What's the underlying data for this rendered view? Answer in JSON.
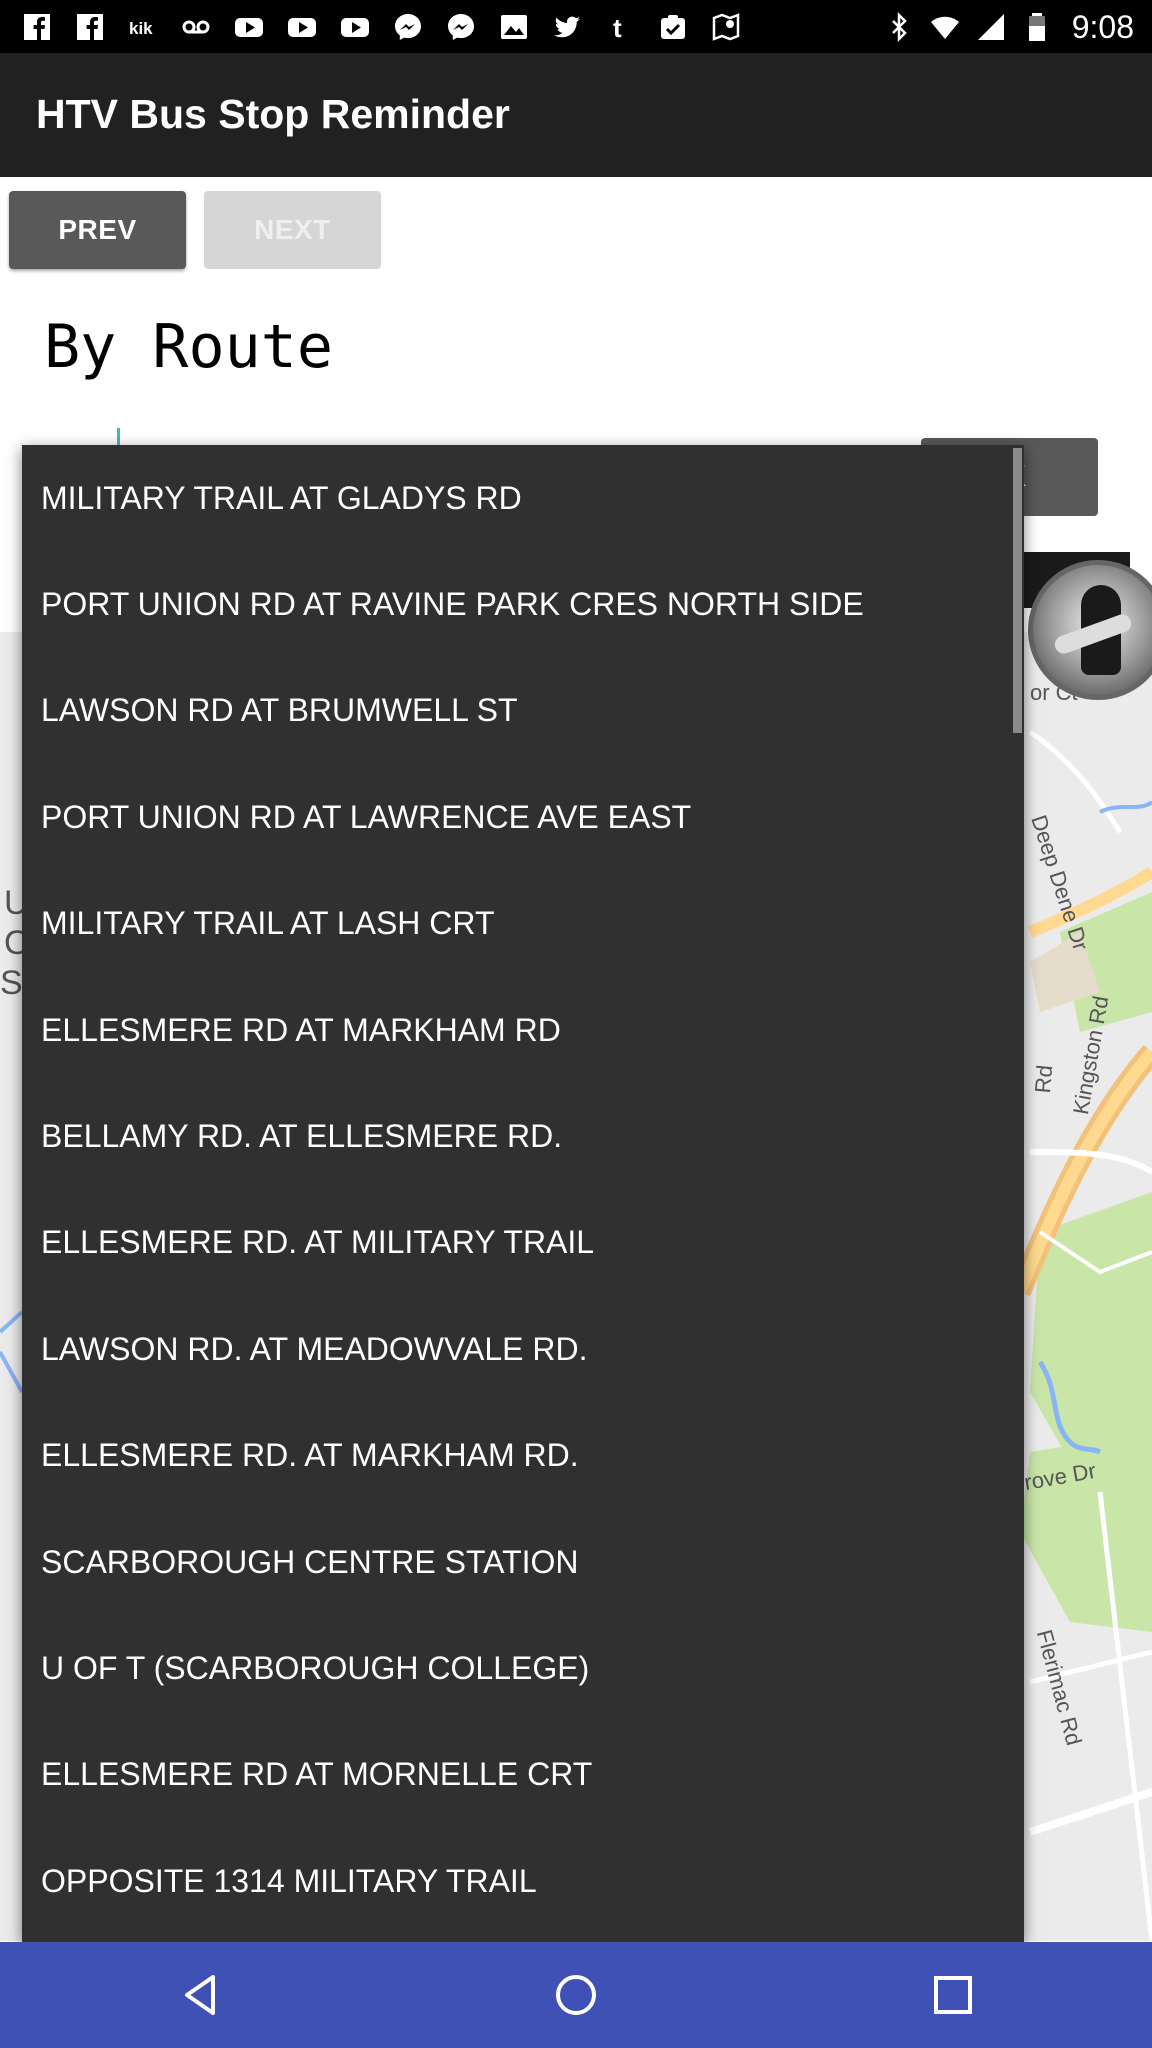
{
  "status_bar": {
    "left_icons": [
      "facebook-icon",
      "facebook-icon",
      "kik-icon",
      "voicemail-icon",
      "youtube-icon",
      "youtube-icon",
      "youtube-icon",
      "messenger-icon",
      "messenger-icon",
      "gallery-icon",
      "twitter-icon",
      "tumblr-icon",
      "clipboard-check-icon",
      "map-icon"
    ],
    "right_icons": [
      "bluetooth-icon",
      "wifi-icon",
      "signal-icon",
      "battery-icon"
    ],
    "time": "9:08"
  },
  "app_bar": {
    "title": "HTV Bus Stop Reminder"
  },
  "buttons": {
    "prev": "PREV",
    "next": "NEXT",
    "ok_partial": "K"
  },
  "heading": "By Route",
  "map_labels": {
    "road1": "or Ct",
    "road2": "Deep Dene Dr",
    "road3": "Kingston Rd",
    "road4": "rove Dr",
    "road5": "Flerimac Rd",
    "road6": "Rd",
    "left_edge1": "U",
    "left_edge2": "O",
    "left_edge3": "Sc"
  },
  "dropdown": {
    "items": [
      "MILITARY TRAIL AT GLADYS RD",
      "PORT UNION RD AT RAVINE PARK CRES NORTH SIDE",
      "LAWSON RD AT BRUMWELL ST",
      "PORT UNION RD AT LAWRENCE AVE EAST",
      "MILITARY TRAIL AT LASH CRT",
      "ELLESMERE RD AT MARKHAM RD",
      "BELLAMY RD. AT ELLESMERE RD.",
      "ELLESMERE RD. AT MILITARY TRAIL",
      "LAWSON RD. AT MEADOWVALE RD.",
      "ELLESMERE RD. AT MARKHAM RD.",
      "SCARBOROUGH CENTRE STATION",
      "U OF T (SCARBOROUGH COLLEGE)",
      "ELLESMERE RD AT MORNELLE CRT",
      "OPPOSITE 1314 MILITARY TRAIL"
    ]
  },
  "nav_bar": {
    "back": "back-icon",
    "home": "home-icon",
    "recents": "recents-icon"
  },
  "colors": {
    "app_bar": "#212121",
    "nav_bar": "#3f51b5",
    "dropdown": "#303030",
    "prev_button": "#595959",
    "next_button_disabled": "#d6d6d6"
  }
}
